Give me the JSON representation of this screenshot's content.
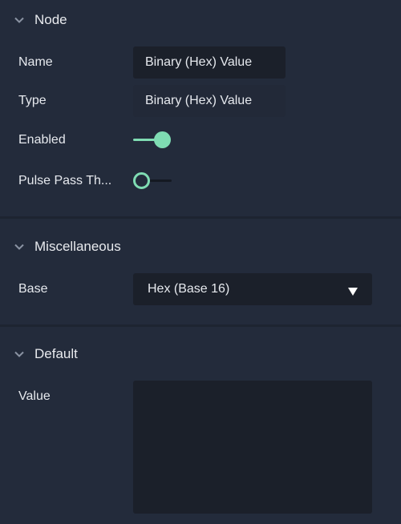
{
  "colors": {
    "accent": "#7fdcb3",
    "panel_bg": "#232b3b",
    "field_bg": "#1b202a"
  },
  "node": {
    "title": "Node",
    "fields": {
      "name": {
        "label": "Name",
        "value": "Binary (Hex) Value"
      },
      "type": {
        "label": "Type",
        "value": "Binary (Hex) Value"
      },
      "enabled": {
        "label": "Enabled",
        "on": true
      },
      "pulse": {
        "label": "Pulse Pass Th...",
        "on": false
      }
    }
  },
  "misc": {
    "title": "Miscellaneous",
    "base": {
      "label": "Base",
      "value": "Hex (Base 16)"
    }
  },
  "default": {
    "title": "Default",
    "value": {
      "label": "Value",
      "value": ""
    }
  },
  "icons": {
    "collapse": "chevron-down-icon",
    "dropdown": "triangle-down-icon"
  }
}
